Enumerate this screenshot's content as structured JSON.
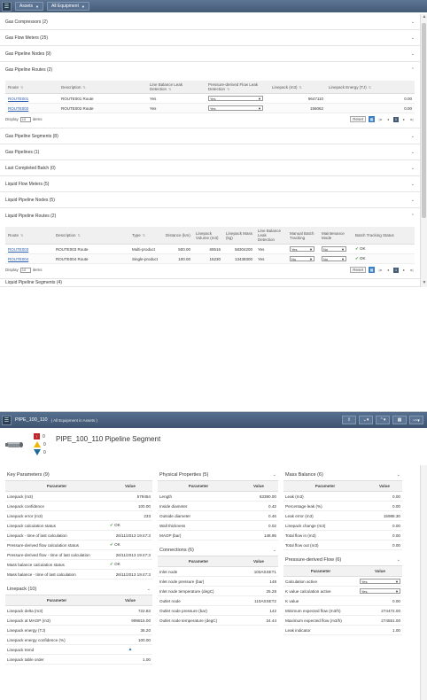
{
  "top": {
    "toolbar": {
      "assets_label": "Assets",
      "equipment_label": "All Equipment"
    },
    "sections": [
      {
        "label": "Gas Compressors (2)",
        "expanded": false
      },
      {
        "label": "Gas Flow Meters (25)",
        "expanded": false
      },
      {
        "label": "Gas Pipeline Nodes (9)",
        "expanded": false
      },
      {
        "label": "Gas Pipeline Routes (2)",
        "expanded": true
      },
      {
        "label": "Gas Pipeline Segments (8)",
        "expanded": false
      },
      {
        "label": "Gas Pipelines (1)",
        "expanded": false
      },
      {
        "label": "Last Completed Batch (0)",
        "expanded": false
      },
      {
        "label": "Liquid Flow Meters (5)",
        "expanded": false
      },
      {
        "label": "Liquid Pipeline Nodes (5)",
        "expanded": false
      },
      {
        "label": "Liquid Pipeline Routes (2)",
        "expanded": true
      }
    ],
    "gas_routes": {
      "headers": [
        "Route",
        "Description",
        "Line Balance Leak Detection",
        "Pressure-derived Flow Leak Detection",
        "Linepack (m3)",
        "Linepack Energy (TJ)"
      ],
      "rows": [
        {
          "route": "ROUTE001",
          "description": "ROUTE001 Route",
          "lbld": "Yes",
          "pdfld": "Yes",
          "linepack": "9647110",
          "energy": "0.00"
        },
        {
          "route": "ROUTE002",
          "description": "ROUTE002 Route",
          "lbld": "Yes",
          "pdfld": "Yes",
          "linepack": "156062",
          "energy": "0.00"
        }
      ],
      "pager": {
        "display": "Display",
        "size": "10",
        "items": "items",
        "reset": "Reset",
        "page": "1"
      }
    },
    "liquid_routes": {
      "headers": [
        "Route",
        "Description",
        "Type",
        "Distance (km)",
        "Linepack Volume (m3)",
        "Linepack Mass (kg)",
        "Line Balance Leak Detection",
        "Manual Batch Tracking",
        "Maintenance Mode",
        "Batch Tracking Status"
      ],
      "rows": [
        {
          "route": "ROUTE003",
          "description": "ROUTE003 Route",
          "type": "Multi-product",
          "distance": "500.00",
          "volume": "69516",
          "mass": "58304200",
          "lbld": "Yes",
          "manual": "Yes",
          "maint": "No",
          "status": "OK"
        },
        {
          "route": "ROUTE004",
          "description": "ROUTE004 Route",
          "type": "Single-product",
          "distance": "100.00",
          "volume": "15230",
          "mass": "13438300",
          "lbld": "Yes",
          "manual": "No",
          "maint": "No",
          "status": "OK"
        }
      ],
      "pager": {
        "display": "Display",
        "size": "10",
        "items": "items",
        "reset": "Reset",
        "page": "1"
      }
    },
    "partial_next": "Liquid Pipeline Segments (4)"
  },
  "bottom": {
    "title": "PIPE_100_110",
    "subtitle": "( All Equipment in Assets )",
    "heading": "PIPE_100_110 Pipeline Segment",
    "status_counts": [
      "0",
      "0",
      "0"
    ],
    "key_params": {
      "title": "Key Parameters (9)",
      "headers": [
        "Parameter",
        "Value"
      ],
      "rows": [
        [
          "Linepack (m3)",
          "579454"
        ],
        [
          "Linepack confidence",
          "100.00"
        ],
        [
          "Linepack error (m3)",
          "233"
        ],
        [
          "Linepack calculation status",
          "OK"
        ],
        [
          "Linepack - time of last calculation",
          "26/11/2013 19:47:3"
        ],
        [
          "Pressure-derived flow calculation status",
          "OK"
        ],
        [
          "Pressure-derived flow - time of last calculation",
          "26/11/2013 19:47:3"
        ],
        [
          "Mass balance calculation status",
          "OK"
        ],
        [
          "Mass balance - time of last calculation",
          "26/11/2013 19:47:3"
        ]
      ]
    },
    "linepack": {
      "title": "Linepack (10)",
      "headers": [
        "Parameter",
        "Value"
      ],
      "rows": [
        [
          "Linepack delta (m3)",
          "722.83"
        ],
        [
          "Linepack at MAOP (m3)",
          "999815.00"
        ],
        [
          "Linepack energy (TJ)",
          "36.20"
        ],
        [
          "Linepack energy confidence (%)",
          "100.00"
        ],
        [
          "Linepack trend",
          ""
        ],
        [
          "Linepack table order",
          "1.00"
        ]
      ]
    },
    "physical": {
      "title": "Physical Properties (5)",
      "headers": [
        "Parameter",
        "Value"
      ],
      "rows": [
        [
          "Length",
          "63390.00"
        ],
        [
          "Inside diameter",
          "0.42"
        ],
        [
          "Outside diameter",
          "0.46"
        ],
        [
          "Wall thickness",
          "0.02"
        ],
        [
          "MAOP (bar)",
          "148.95"
        ]
      ]
    },
    "connections": {
      "title": "Connections (6)",
      "headers": [
        "Parameter",
        "Value"
      ],
      "rows": [
        [
          "Inlet node",
          "100ASSET1"
        ],
        [
          "Inlet node pressure (bar)",
          "148"
        ],
        [
          "Inlet node temperature (degC)",
          "25.28"
        ],
        [
          "Outlet node",
          "110ASSET2"
        ],
        [
          "Outlet node pressure (bar)",
          "142"
        ],
        [
          "Outlet node temperature (degC)",
          "24.44"
        ]
      ]
    },
    "mass_balance": {
      "title": "Mass Balance (6)",
      "headers": [
        "Parameter",
        "Value"
      ],
      "rows": [
        [
          "Leak (m3)",
          "0.00"
        ],
        [
          "Percentage leak (%)",
          "0.00"
        ],
        [
          "Leak error (m3)",
          "15988.30"
        ],
        [
          "Linepack change (m3)",
          "0.00"
        ],
        [
          "Total flow in (m3)",
          "0.00"
        ],
        [
          "Total flow out (m3)",
          "0.00"
        ]
      ]
    },
    "pdf": {
      "title": "Pressure-derived Flow (6)",
      "headers": [
        "Parameter",
        "Value"
      ],
      "rows": [
        [
          "Calculation active",
          "Yes"
        ],
        [
          "K value calculation active",
          "Yes"
        ],
        [
          "K value",
          "0.00"
        ],
        [
          "Minimum expected flow (m3/h)",
          "274472.00"
        ],
        [
          "Maximum expected flow (m3/h)",
          "274551.00"
        ],
        [
          "Leak indicator",
          "1.00"
        ]
      ]
    }
  },
  "colors": {
    "toolbar": "#4d6483",
    "ok": "#3a9a3a",
    "link": "#2a5db0",
    "alarm_red": "#c0272d",
    "alarm_yellow": "#f2b705",
    "alarm_blue": "#1f6b99"
  },
  "icons": [
    "app-icon",
    "chevron-down-icon",
    "chevron-up-icon",
    "excel-export-icon",
    "check-icon",
    "share-icon",
    "grid-icon",
    "trend-icon",
    "pipe-icon"
  ]
}
